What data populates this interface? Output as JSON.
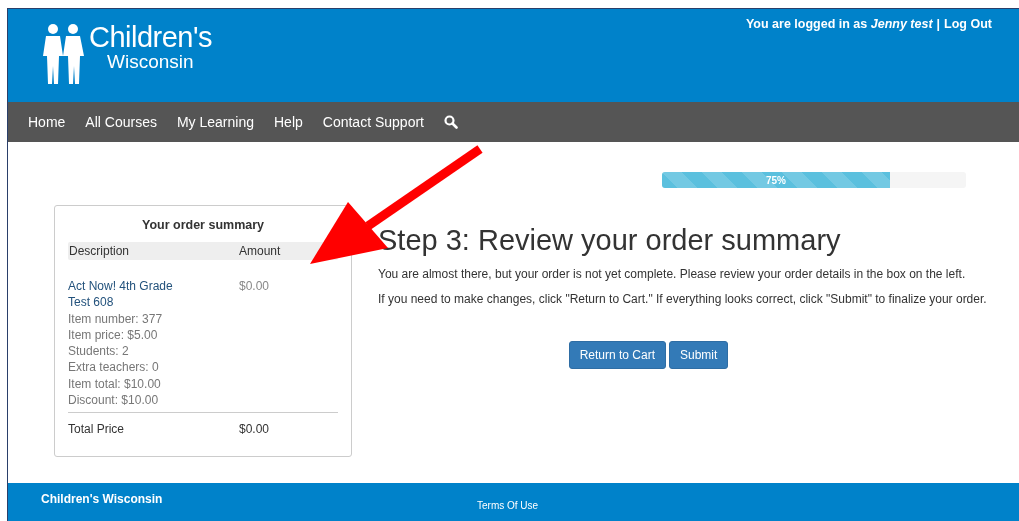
{
  "header": {
    "logo": {
      "line1": "Children's",
      "line2": "Wisconsin"
    },
    "user_text": "You are logged in as **Jenny test**",
    "separator": "|",
    "logout": "Log Out"
  },
  "nav": {
    "items": [
      "Home",
      "All Courses",
      "My Learning",
      "Help",
      "Contact Support"
    ]
  },
  "progress": {
    "level": 0.75,
    "label": "75%"
  },
  "summary": {
    "title": "Your order summary",
    "columns": [
      "Description",
      "Amount"
    ],
    "item": {
      "name": "Act Now! 4th Grade Test 608",
      "amount": "$0.00",
      "details": [
        "Item number: 377",
        "Item price: $5.00",
        "Students: 2",
        "Extra teachers: 0",
        "Item total: $10.00",
        "Discount: $10.00"
      ]
    },
    "total": {
      "label": "Total Price",
      "value": "$0.00"
    }
  },
  "main": {
    "heading": "Step 3: Review your order summary",
    "paragraphs": [
      "You are almost there, but your order is not yet complete. Please review your order details in the box on the left.",
      "If you need to make changes, click \"Return to Cart.\" If everything looks correct, click \"Submit\" to finalize your order."
    ],
    "buttons": [
      "Return to Cart",
      "Submit"
    ]
  },
  "footer": {
    "brand": "Children's Wisconsin",
    "link": "Terms Of Use"
  }
}
